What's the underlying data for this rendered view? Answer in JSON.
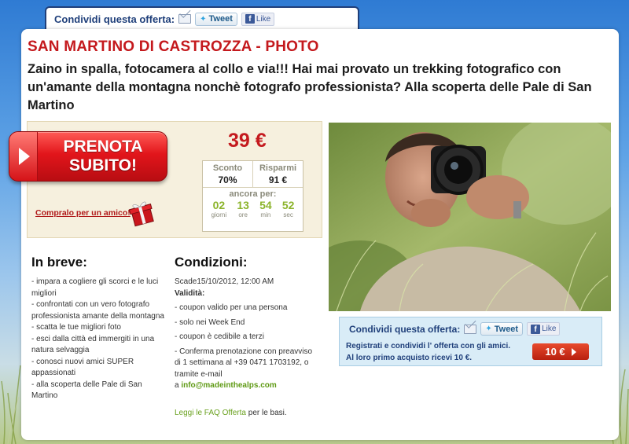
{
  "top_share": {
    "label": "Condividi questa offerta:",
    "tweet": "Tweet",
    "like": "Like"
  },
  "deal": {
    "title": "SAN MARTINO DI CASTROZZA - PHOTO",
    "subtitle": "Zaino in spalla, fotocamera al collo e via!!! Hai mai provato un trekking fotografico con un'amante della montagna nonchè fotografo professionista? Alla scoperta delle Pale di San Martino",
    "price": "39 €",
    "book_button": "PRENOTA SUBITO!",
    "buy_for_friend": "Compralo per un amico!",
    "discount_label": "Sconto",
    "discount_value": "70%",
    "savings_label": "Risparmi",
    "savings_value": "91 €",
    "countdown_label": "ancora per:",
    "countdown": [
      {
        "value": "02",
        "unit": "giorni"
      },
      {
        "value": "13",
        "unit": "ore"
      },
      {
        "value": "54",
        "unit": "min"
      },
      {
        "value": "52",
        "unit": "sec"
      }
    ]
  },
  "in_breve": {
    "title": "In breve:",
    "items": [
      "- impara a cogliere gli scorci e le luci migliori",
      "- confrontati con un vero fotografo professionista amante della montagna",
      "- scatta le tue migliori foto",
      "- esci dalla città ed immergiti in una natura selvaggia",
      "- conosci nuovi amici SUPER appassionati",
      "- alla scoperta delle Pale di San Martino"
    ]
  },
  "condizioni": {
    "title": "Condizioni:",
    "expiry": "Scade15/10/2012, 12:00 AM",
    "validity_label": "Validità:",
    "items": [
      "-  coupon valido per una persona",
      "-  solo nei Week End",
      "-  coupon è cedibile a terzi",
      "-  Conferma prenotazione con preavviso di 1 settimana al +39 0471 1703192, o tramite e-mail"
    ],
    "email_prefix": "a ",
    "email": "info@madeinthealps.com",
    "faq_link": "Leggi le FAQ Offerta",
    "faq_suffix": " per le basi."
  },
  "share_box": {
    "label": "Condividi questa offerta:",
    "tweet": "Tweet",
    "like": "Like",
    "line1": "Registrati e condividi l' offerta con gli amici.",
    "line2": "Al loro primo acquisto ricevi 10 €.",
    "button": "10 €"
  }
}
